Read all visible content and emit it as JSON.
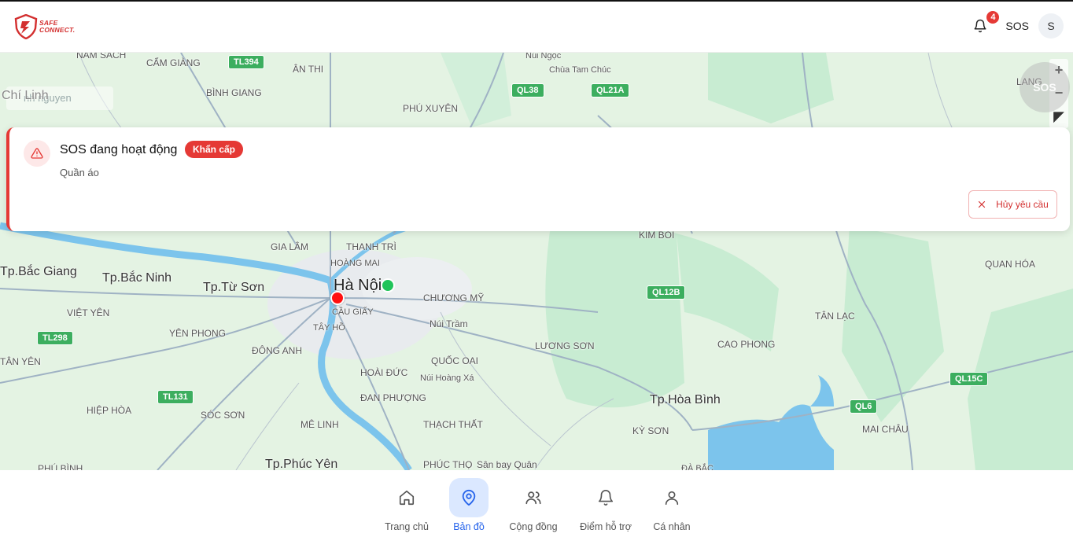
{
  "header": {
    "logo_text_line1": "SAFE",
    "logo_text_line2": "CONNECT.",
    "notification_count": "4",
    "sos_label": "SOS",
    "avatar_initial": "S"
  },
  "map": {
    "search_placeholder": "nh nguyen",
    "zoom_in": "+",
    "zoom_out": "−",
    "sos_fab_label": "SOS",
    "labels": {
      "nam_sach": "NAM SÁCH",
      "cam_giang": "CẨM GIÀNG",
      "an_thi": "ÂN THI",
      "binh_giang": "BÌNH GIANG",
      "chi_linh": "Chí Linh",
      "phu_xuyen": "PHÚ XUYÊN",
      "nui_ngoc": "Núi Ngọc",
      "chua_tam_chuc": "Chùa Tam Chúc",
      "lang": "LANG",
      "gia_lam": "GIA LÂM",
      "thanh_tri": "THANH TRÌ",
      "kim_boi": "KIM BÔI",
      "tp_bac_giang": "Tp.Bắc Giang",
      "tp_bac_ninh": "Tp.Bắc Ninh",
      "tp_tu_son": "Tp.Từ Sơn",
      "hoang_mai": "HOÀNG MAI",
      "ha_noi": "Hà Nội",
      "chuong_my": "CHƯƠNG MỸ",
      "quan_hoa": "QUAN HÓA",
      "viet_yen": "VIỆT YÊN",
      "cau_giay": "CẦU GIẤY",
      "tay_ho": "TÂY HỒ",
      "nui_tram": "Núi Trầm",
      "tan_lac": "TÂN LẠC",
      "yen_phong": "YÊN PHONG",
      "luong_son": "LƯƠNG SƠN",
      "cao_phong": "CAO PHONG",
      "tan_yen": "TÂN YÊN",
      "dong_anh": "ĐÔNG ANH",
      "quoc_oai": "QUỐC OAI",
      "hoai_duc": "HOÀI ĐỨC",
      "nui_hoang_xa": "Núi Hoàng Xá",
      "dan_phuong": "ĐAN PHƯỢNG",
      "tp_hoa_binh": "Tp.Hòa Bình",
      "hiep_hoa": "HIỆP HÒA",
      "soc_son": "SÓC SƠN",
      "me_linh": "MÊ LINH",
      "thach_that": "THẠCH THẤT",
      "ky_son": "KỲ SƠN",
      "mai_chau": "MAI CHÂU",
      "phu_binh": "PHÚ BÌNH",
      "tp_phuc_yen": "Tp.Phúc Yên",
      "phuc_tho": "PHÚC THỌ",
      "san_bay_quan": "Sân bay Quân",
      "da_bac": "ĐÀ BẮC"
    },
    "roads": {
      "tl394": "TL394",
      "ql38": "QL38",
      "ql21a": "QL21A",
      "ql12b": "QL12B",
      "tl298": "TL298",
      "tl131": "TL131",
      "ql15c": "QL15C",
      "ql6": "QL6"
    },
    "colors": {
      "land": "#e4f3e3",
      "forest": "#c8ecd2",
      "water": "#7cc4ec",
      "road_badge": "#3cae5f",
      "user_marker": "#ff1010",
      "other_marker": "#21c45a"
    }
  },
  "alert": {
    "title": "SOS đang hoạt động",
    "badge": "Khẩn cấp",
    "subtitle": "Quần áo",
    "cancel_label": "Hủy yêu cầu",
    "accent_color": "#e53935"
  },
  "bottom_nav": {
    "items": [
      {
        "label": "Trang chủ",
        "icon": "home-icon"
      },
      {
        "label": "Bản đồ",
        "icon": "map-pin-icon",
        "active": true
      },
      {
        "label": "Cộng đồng",
        "icon": "users-icon"
      },
      {
        "label": "Điểm hỗ trợ",
        "icon": "bell-icon"
      },
      {
        "label": "Cá nhân",
        "icon": "user-icon"
      }
    ],
    "active_color": "#2563eb"
  }
}
